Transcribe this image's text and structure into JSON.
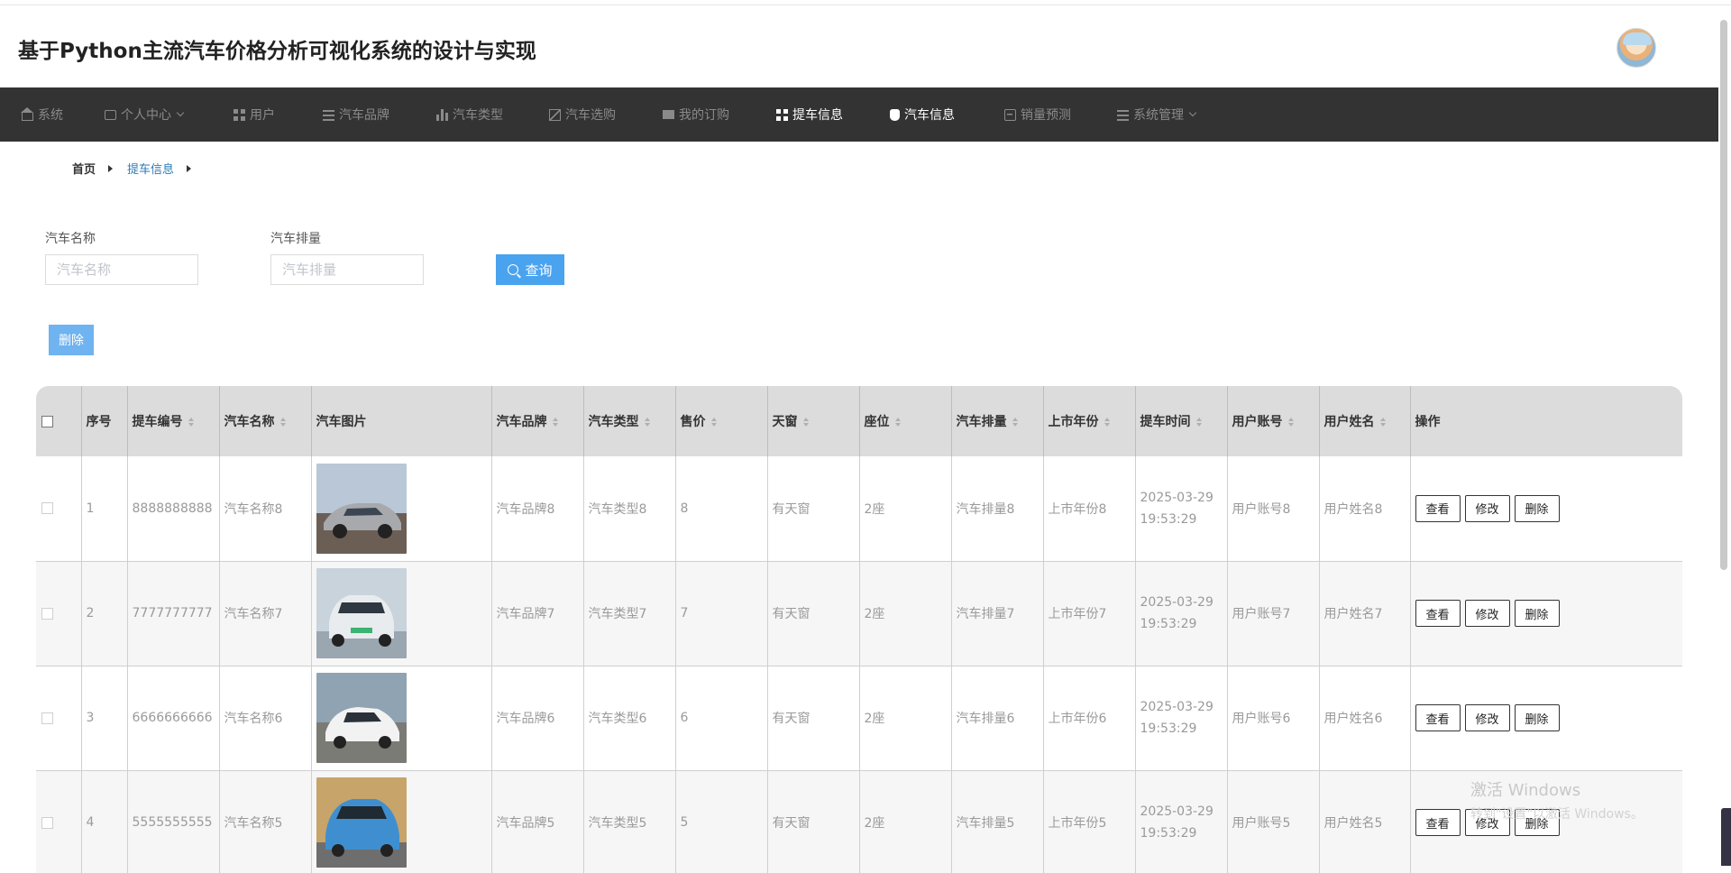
{
  "header": {
    "title": "基于Python主流汽车价格分析可视化系统的设计与实现"
  },
  "nav": {
    "items": [
      {
        "label": "系统",
        "icon": "home-icon",
        "active": false
      },
      {
        "label": "个人中心",
        "icon": "card-icon",
        "active": false,
        "dropdown": true
      },
      {
        "label": "用户",
        "icon": "grid-icon",
        "active": false
      },
      {
        "label": "汽车品牌",
        "icon": "list-icon",
        "active": false
      },
      {
        "label": "汽车类型",
        "icon": "bar-chart-icon",
        "active": false
      },
      {
        "label": "汽车选购",
        "icon": "chart-icon",
        "active": false
      },
      {
        "label": "我的订购",
        "icon": "monitor-icon",
        "active": false
      },
      {
        "label": "提车信息",
        "icon": "grid-icon",
        "active": true
      },
      {
        "label": "汽车信息",
        "icon": "hand-cursor-icon",
        "active": true
      },
      {
        "label": "销量预测",
        "icon": "clipboard-icon",
        "active": false
      },
      {
        "label": "系统管理",
        "icon": "list-icon",
        "active": false,
        "dropdown": true
      }
    ]
  },
  "breadcrumb": {
    "home": "首页",
    "current": "提车信息"
  },
  "search": {
    "name_label": "汽车名称",
    "name_placeholder": "汽车名称",
    "displacement_label": "汽车排量",
    "displacement_placeholder": "汽车排量",
    "query_label": "查询"
  },
  "batch_delete_label": "删除",
  "table": {
    "headers": [
      "序号",
      "提车编号",
      "汽车名称",
      "汽车图片",
      "汽车品牌",
      "汽车类型",
      "售价",
      "天窗",
      "座位",
      "汽车排量",
      "上市年份",
      "提车时间",
      "用户账号",
      "用户姓名",
      "操作"
    ],
    "rows": [
      {
        "index": "1",
        "code": "8888888888",
        "name": "汽车名称8",
        "brand": "汽车品牌8",
        "type": "汽车类型8",
        "price": "8",
        "sunroof": "有天窗",
        "seats": "2座",
        "displacement": "汽车排量8",
        "year": "上市年份8",
        "time": "2025-03-29 19:53:29",
        "account": "用户账号8",
        "username": "用户姓名8"
      },
      {
        "index": "2",
        "code": "7777777777",
        "name": "汽车名称7",
        "brand": "汽车品牌7",
        "type": "汽车类型7",
        "price": "7",
        "sunroof": "有天窗",
        "seats": "2座",
        "displacement": "汽车排量7",
        "year": "上市年份7",
        "time": "2025-03-29 19:53:29",
        "account": "用户账号7",
        "username": "用户姓名7"
      },
      {
        "index": "3",
        "code": "6666666666",
        "name": "汽车名称6",
        "brand": "汽车品牌6",
        "type": "汽车类型6",
        "price": "6",
        "sunroof": "有天窗",
        "seats": "2座",
        "displacement": "汽车排量6",
        "year": "上市年份6",
        "time": "2025-03-29 19:53:29",
        "account": "用户账号6",
        "username": "用户姓名6"
      },
      {
        "index": "4",
        "code": "5555555555",
        "name": "汽车名称5",
        "brand": "汽车品牌5",
        "type": "汽车类型5",
        "price": "5",
        "sunroof": "有天窗",
        "seats": "2座",
        "displacement": "汽车排量5",
        "year": "上市年份5",
        "time": "2025-03-29 19:53:29",
        "account": "用户账号5",
        "username": "用户姓名5"
      }
    ],
    "actions": {
      "view": "查看",
      "edit": "修改",
      "delete": "删除"
    }
  },
  "watermark": {
    "line1": "激活 Windows",
    "line2": "转到\"设置\"以激活 Windows。"
  },
  "colors": {
    "nav_bg": "#333333",
    "primary": "#4aa3ef",
    "link": "#2d7bb6",
    "header_row": "#dcdcdc"
  }
}
